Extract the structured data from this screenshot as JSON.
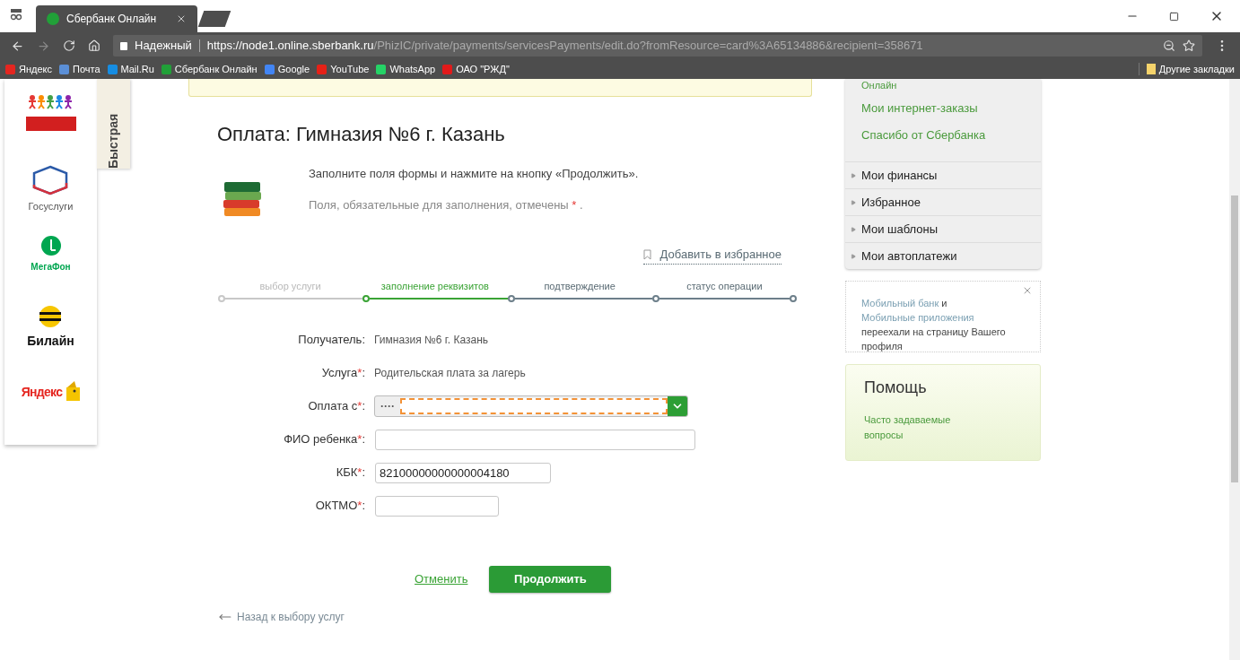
{
  "browser": {
    "tab_title": "Сбербанк Онлайн",
    "security": "Надежный",
    "url_host": "https://node1.online.sberbank.ru",
    "url_path": "/PhizIC/private/payments/servicesPayments/edit.do?fromResource=card%3A65134886&recipient=358671",
    "bookmarks": [
      {
        "label": "Яндекс",
        "color": "#e52620"
      },
      {
        "label": "Почта",
        "color": "#5b8fd6"
      },
      {
        "label": "Mail.Ru",
        "color": "#168de2"
      },
      {
        "label": "Сбербанк Онлайн",
        "color": "#21a038"
      },
      {
        "label": "Google",
        "color": "#4285f4"
      },
      {
        "label": "YouTube",
        "color": "#e62117"
      },
      {
        "label": "WhatsApp",
        "color": "#25d366"
      },
      {
        "label": "ОАО \"РЖД\"",
        "color": "#e21a1a"
      }
    ],
    "other_bookmarks": "Другие закладки"
  },
  "sidebar": {
    "items": [
      {
        "kind": "people"
      },
      {
        "kind": "gosuslugi",
        "caption": "Госуслуги"
      },
      {
        "kind": "megafon",
        "caption": "МегаФон"
      },
      {
        "kind": "beeline",
        "caption": "Билайн"
      },
      {
        "kind": "yandex",
        "caption": "Яндекс"
      }
    ],
    "quick_tab": "Быстрая"
  },
  "main": {
    "title": "Оплата: Гимназия №6 г. Казань",
    "instruction": "Заполните поля формы и нажмите на кнопку «Продолжить».",
    "required_note": "Поля, обязательные для заполнения, отмечены",
    "required_mark": "*",
    "required_end": ".",
    "favorite_link": "Добавить в избранное",
    "steps": [
      {
        "label": "выбор услуги",
        "done": true,
        "selected": false
      },
      {
        "label": "заполнение реквизитов",
        "done": false,
        "selected": true
      },
      {
        "label": "подтверждение",
        "done": false,
        "selected": false
      },
      {
        "label": "статус операции",
        "done": false,
        "selected": false
      }
    ],
    "fields": [
      {
        "kind": "static",
        "label": "Получатель",
        "colon": ":",
        "value": "Гимназия №6 г. Казань"
      },
      {
        "kind": "static",
        "label": "Услуга",
        "mark": "*",
        "colon": ":",
        "value": "Родительская плата за лагерь"
      },
      {
        "kind": "select",
        "label": "Оплата с",
        "mark": "*",
        "colon": ":",
        "value": "····"
      },
      {
        "kind": "input",
        "label": "ФИО ребенка",
        "mark": "*",
        "colon": ":"
      },
      {
        "kind": "input",
        "label": "КБК",
        "mark": "*",
        "colon": ":",
        "value": "82100000000000004180"
      },
      {
        "kind": "input",
        "label": "ОКТМО",
        "mark": "*",
        "colon": ":"
      }
    ],
    "cancel": "Отменить",
    "continue": "Продолжить",
    "back_link": "Назад к выбору услуг"
  },
  "right": {
    "links": [
      "Онлайн",
      "Мои интернет-заказы",
      "Спасибо от Сбербанка"
    ],
    "sections": [
      "Мои финансы",
      "Избранное",
      "Мои шаблоны",
      "Мои автоплатежи"
    ],
    "notice": {
      "link1": "Мобильный банк",
      "join": "и",
      "link2": "Мобильные приложения",
      "rest": "переехали на страницу Вашего профиля"
    },
    "help": {
      "title": "Помощь",
      "link": "Часто задаваемые вопросы"
    }
  }
}
